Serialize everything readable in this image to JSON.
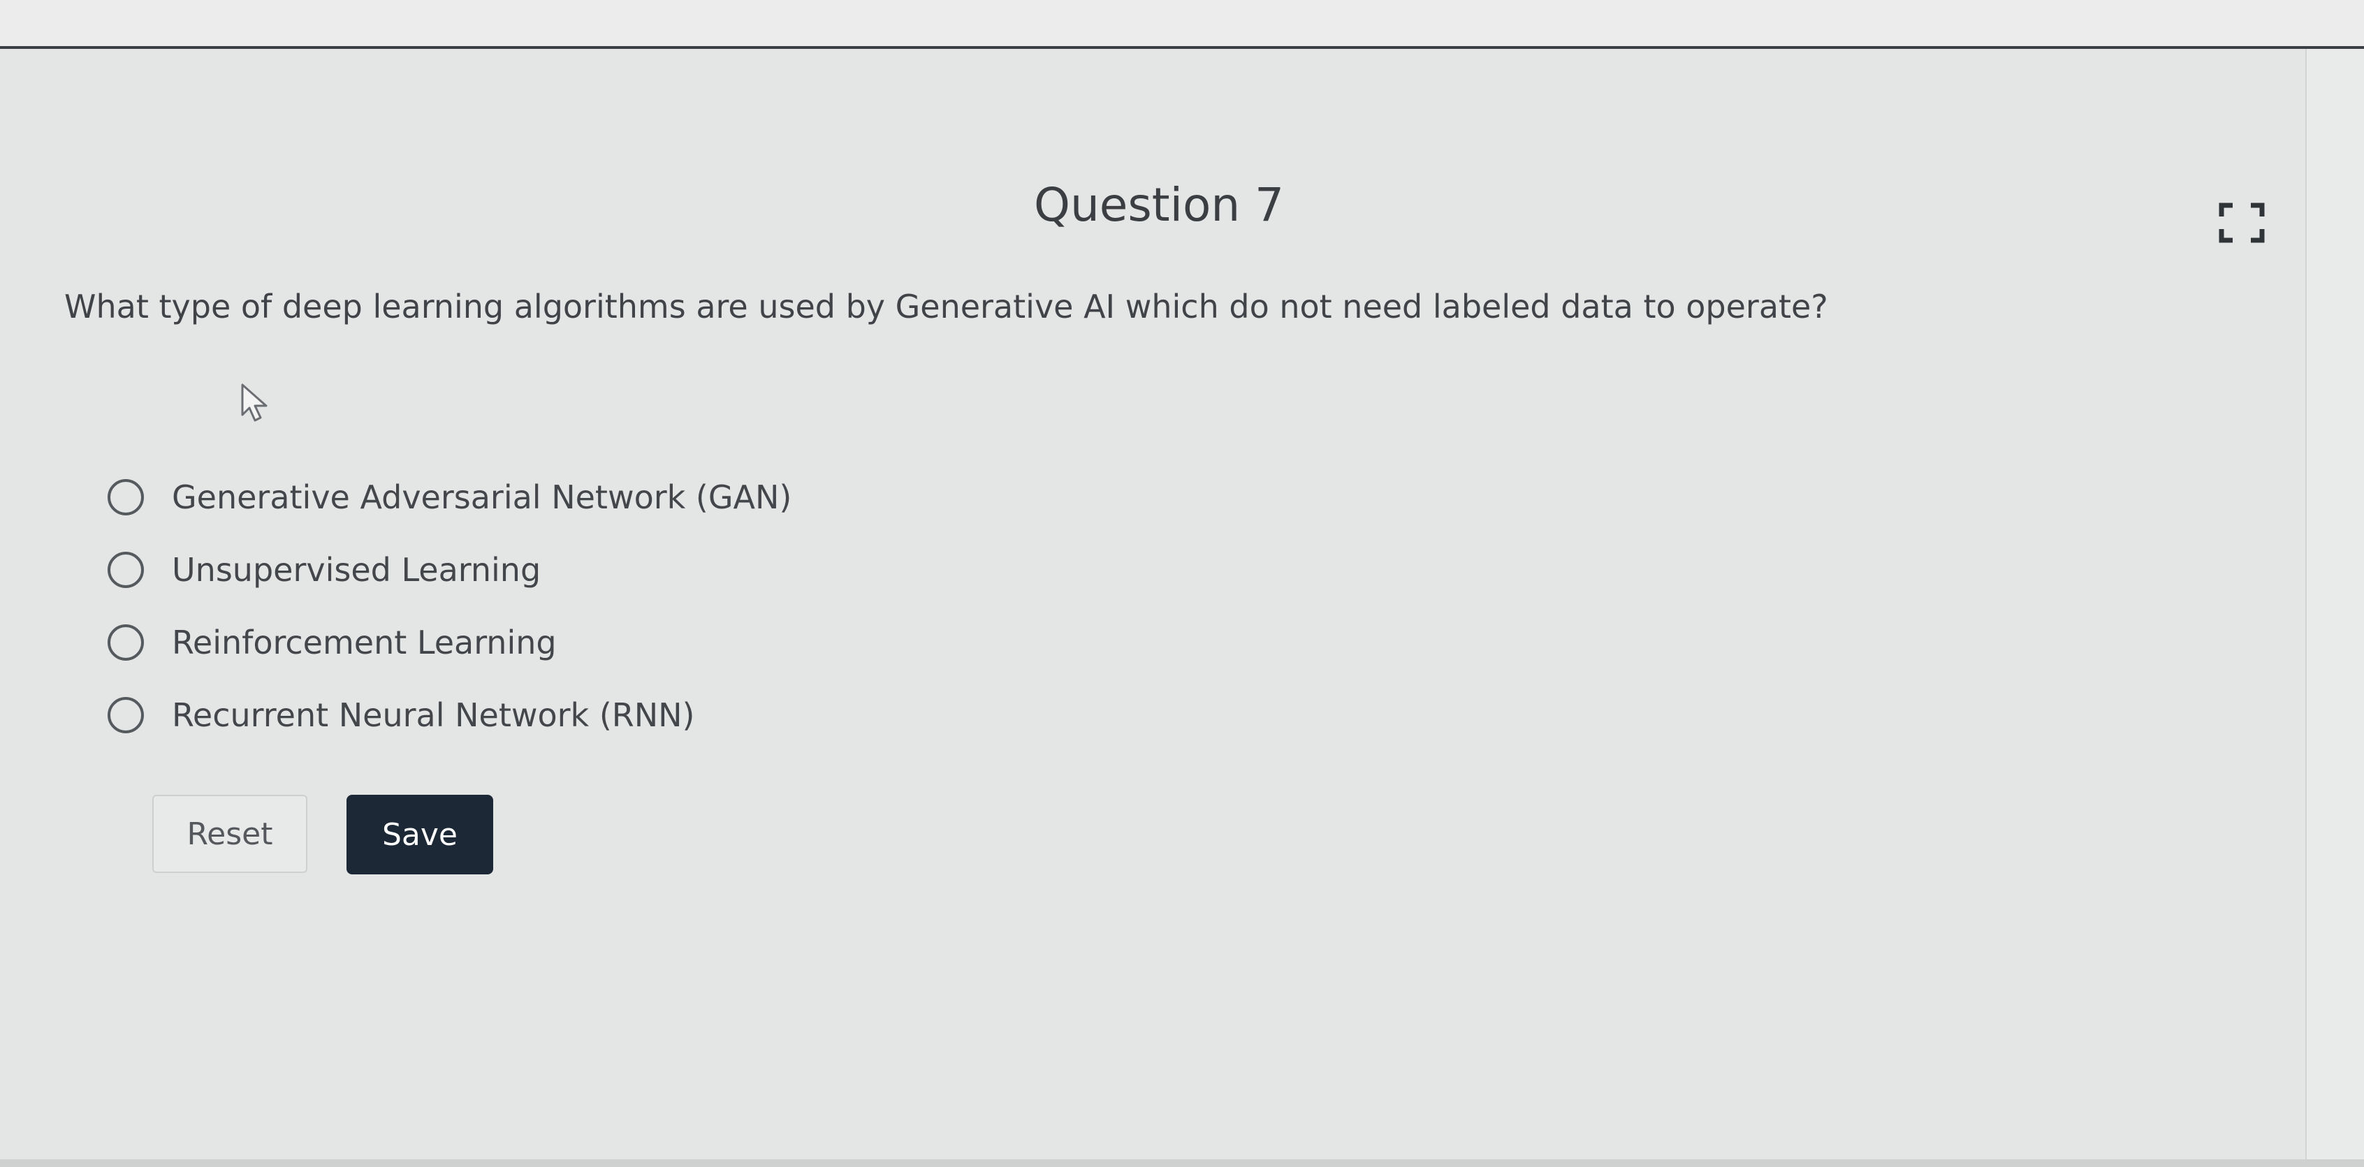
{
  "question": {
    "title": "Question 7",
    "prompt": "What type of deep learning algorithms are used by Generative AI which do not need labeled data to operate?",
    "options": [
      {
        "label": "Generative Adversarial Network (GAN)",
        "selected": false
      },
      {
        "label": "Unsupervised Learning",
        "selected": false
      },
      {
        "label": "Reinforcement Learning",
        "selected": false
      },
      {
        "label": "Recurrent Neural Network (RNN)",
        "selected": false
      }
    ]
  },
  "actions": {
    "reset_label": "Reset",
    "save_label": "Save"
  },
  "icons": {
    "expand": "expand-icon",
    "cursor": "cursor-icon"
  },
  "colors": {
    "save_button": "#1d2836",
    "background": "#e9eaea"
  }
}
